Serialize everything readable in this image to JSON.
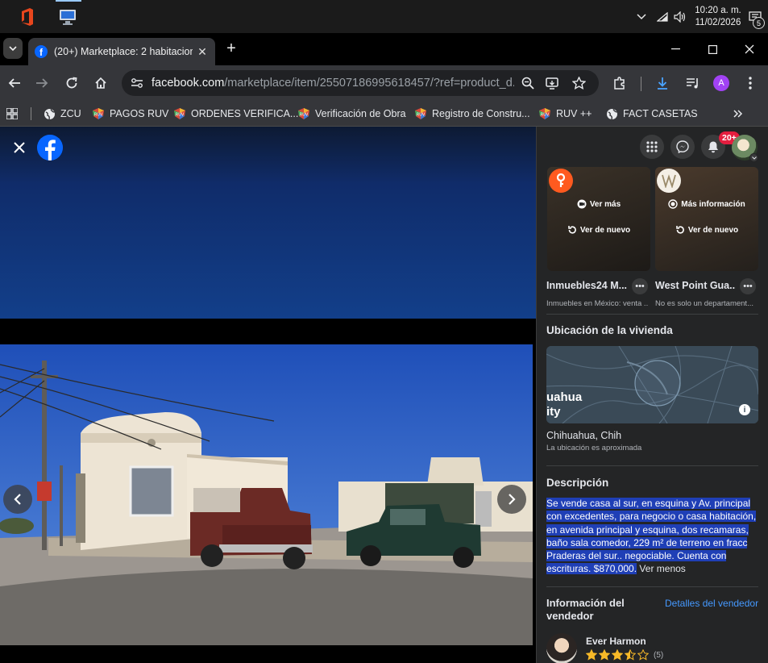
{
  "taskbar": {
    "time": "10:20 a. m.",
    "date": "11/02/2026",
    "notification_count": "5",
    "tray_icons": [
      "chevron-up-icon",
      "wifi-icon",
      "volume-icon"
    ],
    "apps": [
      "office-app-icon",
      "remote-desktop-icon"
    ]
  },
  "browser": {
    "tab": {
      "title": "(20+) Marketplace: 2 habitacion"
    },
    "url": {
      "host": "facebook.com",
      "path": "/marketplace/item/25507186995618457/?ref=product_d..."
    },
    "profile_initial": "A",
    "bookmarks": [
      {
        "label": "ZCU",
        "icon": "globe-icon"
      },
      {
        "label": "PAGOS RUV",
        "icon": "ruv-icon"
      },
      {
        "label": "ORDENES VERIFICA...",
        "icon": "ruv-icon"
      },
      {
        "label": "Verificación de Obra",
        "icon": "ruv-icon"
      },
      {
        "label": "Registro de Constru...",
        "icon": "ruv-icon"
      },
      {
        "label": "RUV ++",
        "icon": "ruv-icon"
      },
      {
        "label": "FACT CASETAS",
        "icon": "globe-icon"
      }
    ]
  },
  "facebook": {
    "notifications_badge": "20+",
    "colors": {
      "accent": "#0866ff",
      "badge": "#e41e3f",
      "link": "#4599ff",
      "star": "#f7b928",
      "selection": "#1f3fb6"
    },
    "ads": [
      {
        "name": "Inmuebles24 M...",
        "subtitle": "Inmuebles en México: venta ...",
        "action1": "Ver más",
        "action2": "Ver de nuevo"
      },
      {
        "name": "West Point Gua...",
        "subtitle": "No es solo un departament...",
        "action1": "Más información",
        "action2": "Ver de nuevo"
      }
    ],
    "location": {
      "heading": "Ubicación de la vivienda",
      "map_label_line1": "uahua",
      "map_label_line2": "ity",
      "city": "Chihuahua, Chih",
      "note": "La ubicación es aproximada"
    },
    "description": {
      "heading": "Descripción",
      "text": "Se vende casa al sur, en esquina y Av. principal con excedentes, para negocio o casa habitación, en avenida principal y esquina, dos recamaras, baño sala comedor, 229 m² de terreno en fracc Praderas del sur.. negociable. Cuenta con escrituras. $870,000.",
      "see_less": "Ver menos"
    },
    "seller": {
      "heading": "Información del vendedor",
      "details_link": "Detalles del vendedor",
      "name": "Ever Harmon",
      "rating": 3.5,
      "rating_count": "(5)"
    }
  }
}
